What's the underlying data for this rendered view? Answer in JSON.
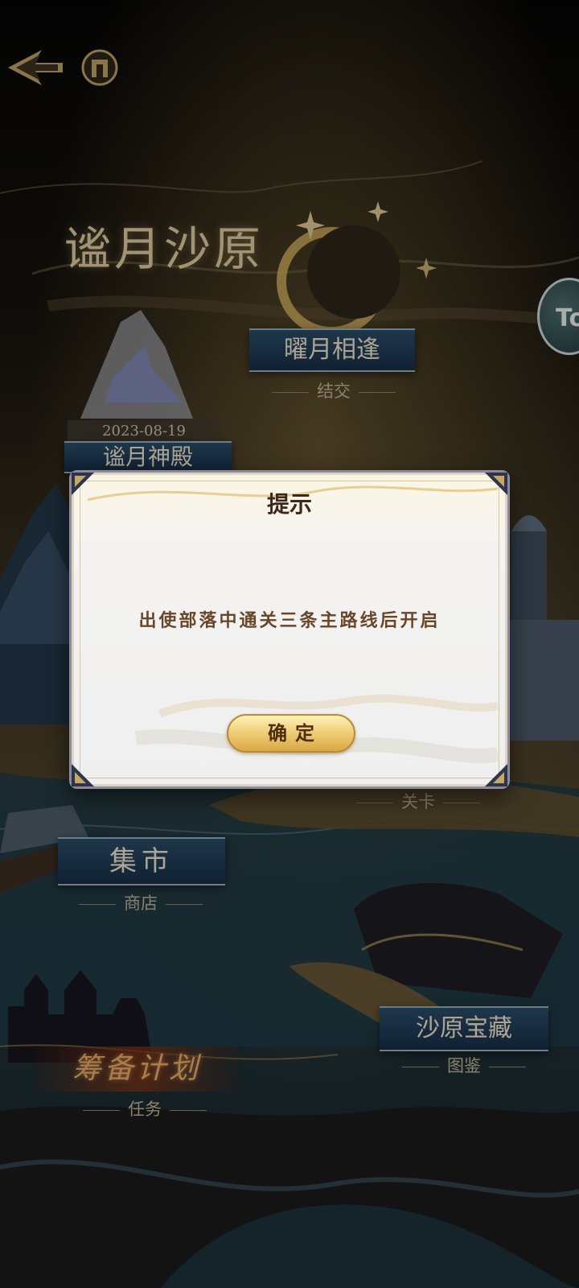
{
  "header": {
    "title": "谧月沙原",
    "side_badge": "To"
  },
  "map": {
    "yaoyue": {
      "label": "曜月相逢",
      "sub": "结交"
    },
    "temple": {
      "date": "2023-08-19",
      "label": "谧月神殿"
    },
    "checkpoint_sub": "关卡",
    "market": {
      "label": "集市",
      "sub": "商店"
    },
    "treasure": {
      "label": "沙原宝藏",
      "sub": "图鉴"
    },
    "plan": {
      "label": "筹备计划",
      "sub": "任务"
    }
  },
  "dialog": {
    "title": "提示",
    "message": "出使部落中通关三条主路线后开启",
    "confirm_label": "确定"
  },
  "colors": {
    "gold": "#d9c49a",
    "banner_blue": "#1d3852",
    "dialog_bg": "#efeff0",
    "button_gold": "#f1d07a"
  }
}
